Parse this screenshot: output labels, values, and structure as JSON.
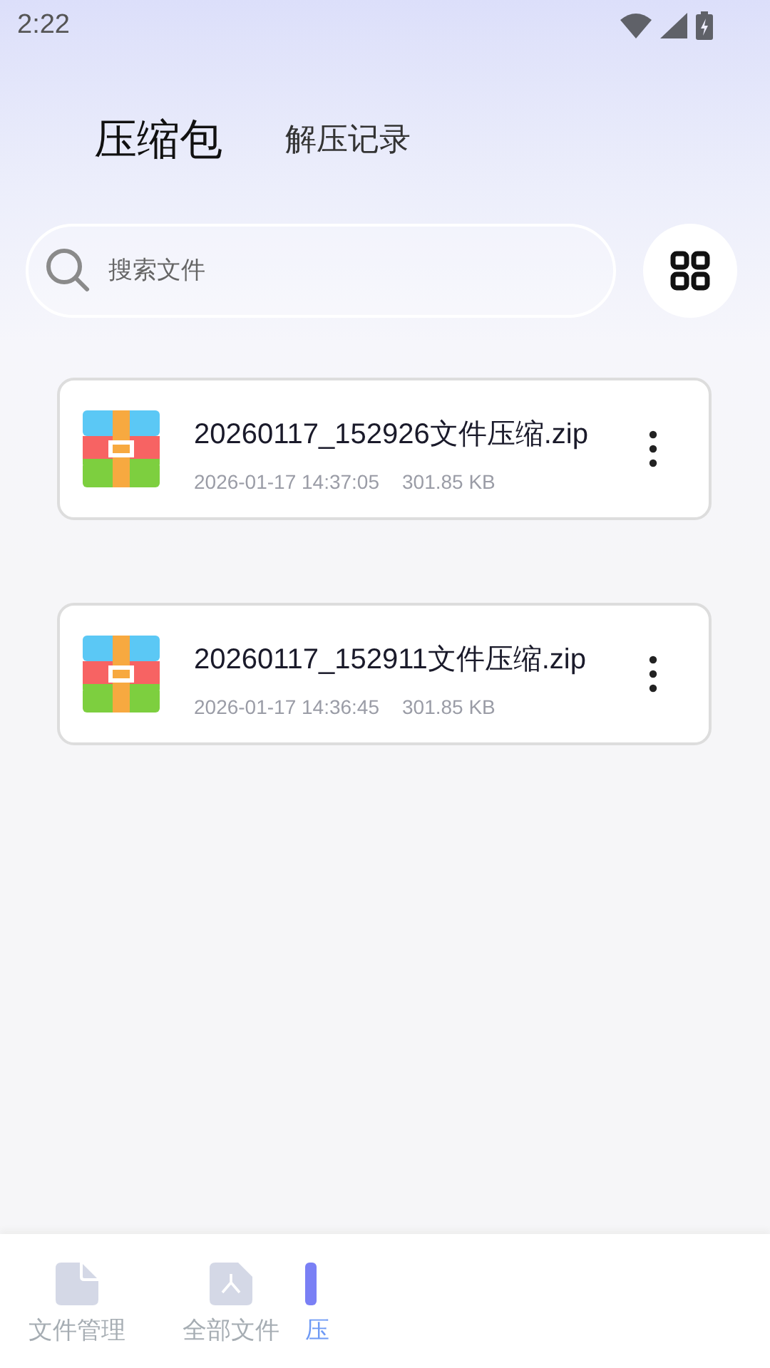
{
  "status_bar": {
    "time": "2:22"
  },
  "tabs": [
    {
      "label": "压缩包",
      "selected": true
    },
    {
      "label": "解压记录",
      "selected": false
    }
  ],
  "search": {
    "placeholder": "搜索文件"
  },
  "files": [
    {
      "name": "20260117_152926文件压缩.zip",
      "date": "2026-01-17 14:37:05",
      "size": "301.85 KB"
    },
    {
      "name": "20260117_152911文件压缩.zip",
      "date": "2026-01-17 14:36:45",
      "size": "301.85 KB"
    }
  ],
  "bottom_nav": [
    {
      "label": "文件管理",
      "kind": "file",
      "selected": false
    },
    {
      "label": "全部文件",
      "kind": "pdf",
      "selected": false
    },
    {
      "label": "压",
      "kind": "zip",
      "selected": true
    }
  ]
}
